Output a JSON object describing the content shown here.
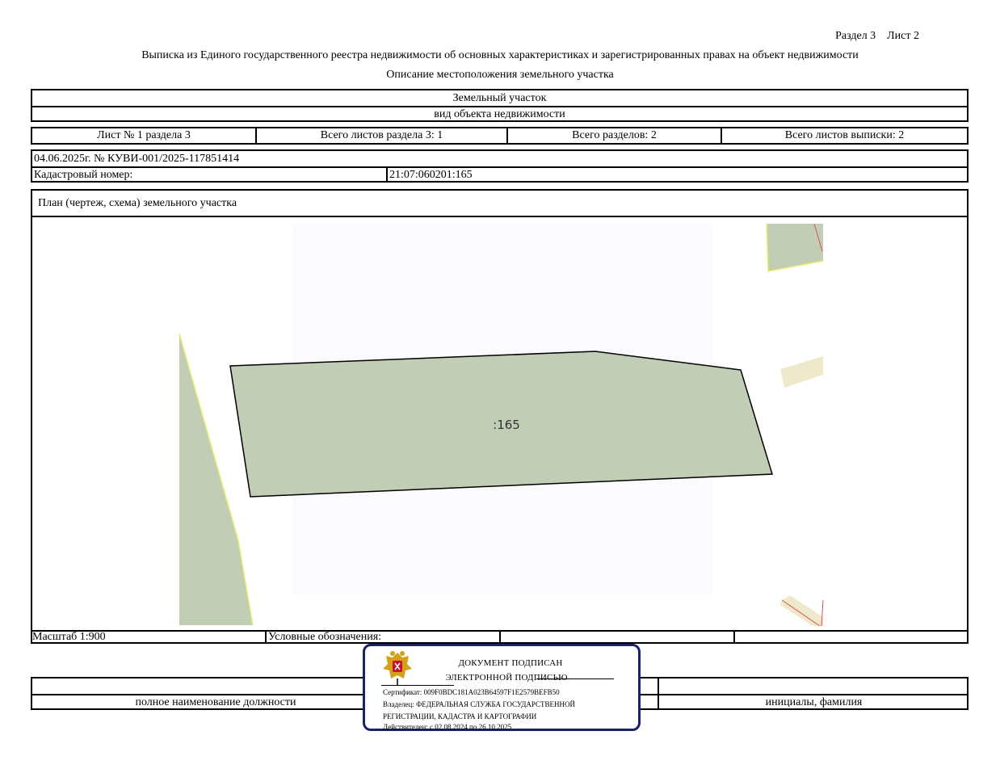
{
  "header": {
    "section_sheet": "Раздел 3    Лист 2",
    "title": "Выписка из Единого государственного реестра недвижимости об основных характеристиках и зарегистрированных правах на объект недвижимости",
    "subtitle": "Описание местоположения земельного участка"
  },
  "object": {
    "type_value": "Земельный участок",
    "type_caption": "вид объекта недвижимости"
  },
  "sheets": {
    "sheet_of_section": "Лист № 1 раздела 3",
    "total_sheets_section": "Всего листов раздела 3: 1",
    "total_sections": "Всего разделов: 2",
    "total_sheets_extract": "Всего листов выписки: 2"
  },
  "record": {
    "date_number": "04.06.2025г. № КУВИ-001/2025-117851414",
    "cadastral_label": "Кадастровый номер:",
    "cadastral_value": "21:07:060201:165"
  },
  "plan": {
    "heading": "План (чертеж, схема) земельного участка",
    "parcel_label": ":165",
    "colors": {
      "parcel_fill": "#c2cdb5",
      "neighbor_fill": "#efe9cc",
      "boundary": "#000000",
      "edge_highlight": "#e8f070",
      "red_line": "#e05050"
    }
  },
  "footer": {
    "scale": "Масштаб 1:900",
    "legend_label": "Условные обозначения:",
    "position_caption": "полное наименование должности",
    "signature_caption": "инициалы, фамилия"
  },
  "stamp": {
    "line1": "ДОКУМЕНТ ПОДПИСАН",
    "line2": "ЭЛЕКТРОННОЙ ПОДПИСЬЮ",
    "certificate": "Сертификат: 009F0BDC181A023B64597F1E2579BEFB50",
    "owner_1": "Владелец: ФЕДЕРАЛЬНАЯ СЛУЖБА ГОСУДАРСТВЕННОЙ",
    "owner_2": "РЕГИСТРАЦИИ, КАДАСТРА И КАРТОГРАФИИ",
    "valid": "Действителен: с 02.08.2024 по 26.10.2025",
    "emblem_icon": "russian-coat-of-arms-icon",
    "border_color": "#1a1f6e"
  }
}
